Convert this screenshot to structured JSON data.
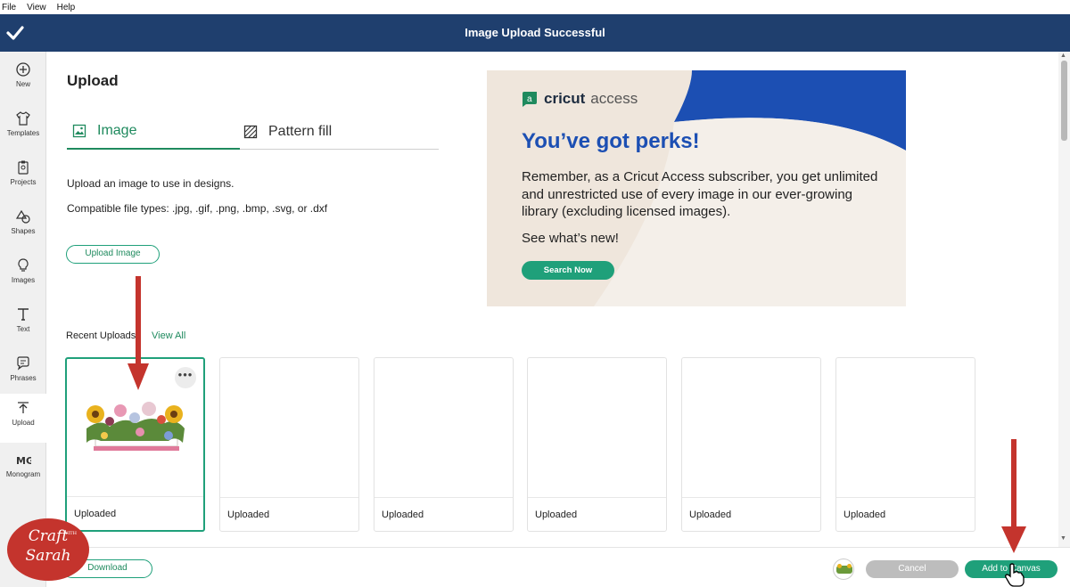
{
  "menubar": {
    "items": [
      "File",
      "View",
      "Help"
    ]
  },
  "header": {
    "title": "Image Upload Successful",
    "check_icon": "check-icon"
  },
  "sidebar": {
    "items": [
      {
        "label": "New",
        "icon": "plus-circle-icon"
      },
      {
        "label": "Templates",
        "icon": "shirt-icon"
      },
      {
        "label": "Projects",
        "icon": "clipboard-icon"
      },
      {
        "label": "Shapes",
        "icon": "shapes-icon"
      },
      {
        "label": "Images",
        "icon": "lightbulb-icon"
      },
      {
        "label": "Text",
        "icon": "text-icon"
      },
      {
        "label": "Phrases",
        "icon": "speech-bubble-icon"
      },
      {
        "label": "Upload",
        "icon": "upload-icon"
      },
      {
        "label": "Monogram",
        "icon": "monogram-icon"
      }
    ],
    "active": "Upload"
  },
  "main": {
    "title": "Upload",
    "tabs": [
      {
        "label": "Image",
        "icon": "image-icon",
        "active": true
      },
      {
        "label": "Pattern fill",
        "icon": "pattern-icon",
        "active": false
      }
    ],
    "description": "Upload an image to use in designs.",
    "file_types": "Compatible file types: .jpg, .gif, .png, .bmp, .svg, or .dxf",
    "upload_button": "Upload Image"
  },
  "promo": {
    "brand": "cricut",
    "brand_suffix": "access",
    "headline": "You’ve got perks!",
    "body": "Remember, as a Cricut Access subscriber, you get unlimited and unrestricted use of every image in our ever-growing library (excluding licensed images).",
    "see_new": "See what’s new!",
    "button": "Search Now",
    "colors": {
      "bg": "#efe6dc",
      "blue": "#1c4fb3",
      "green": "#1fa07a"
    }
  },
  "recent": {
    "label": "Recent Uploads",
    "view_all": "View All",
    "cards": [
      {
        "label": "Uploaded",
        "selected": true,
        "has_image": true
      },
      {
        "label": "Uploaded",
        "selected": false
      },
      {
        "label": "Uploaded",
        "selected": false
      },
      {
        "label": "Uploaded",
        "selected": false
      },
      {
        "label": "Uploaded",
        "selected": false
      },
      {
        "label": "Uploaded",
        "selected": false
      }
    ],
    "more_icon": "ellipsis-icon"
  },
  "bottombar": {
    "download": "Download",
    "cancel": "Cancel",
    "add_to_canvas": "Add to Canvas"
  },
  "watermark": {
    "line1": "Craft",
    "line2": "WITH",
    "line3": "Sarah"
  },
  "colors": {
    "header": "#1f3f6e",
    "accent_green": "#1fa07a",
    "arrow_red": "#c4342d"
  }
}
